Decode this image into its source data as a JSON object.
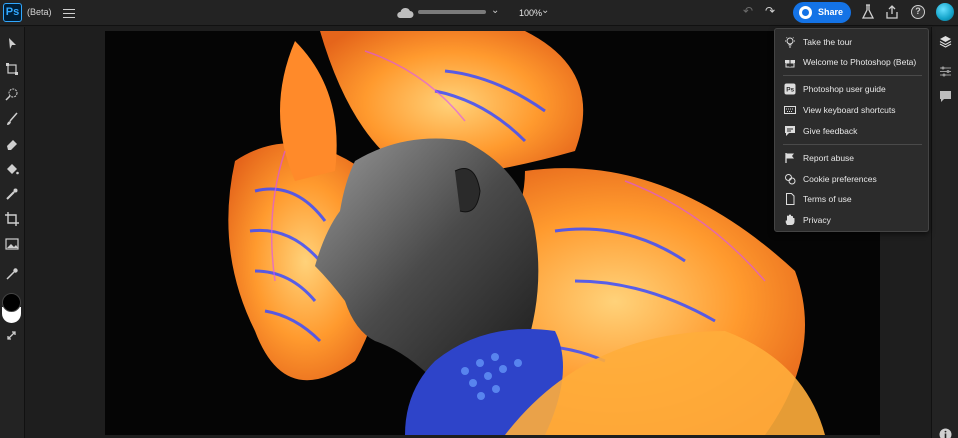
{
  "app": {
    "logo_text": "Ps",
    "title_suffix": "(Beta)"
  },
  "toolbar": {
    "zoom_level": "100%",
    "share_label": "Share"
  },
  "help_menu": {
    "items": [
      {
        "label": "Take the tour",
        "icon": "lightbulb-icon"
      },
      {
        "label": "Welcome to Photoshop (Beta)",
        "icon": "gift-icon"
      },
      {
        "label": "Photoshop user guide",
        "icon": "ps-guide-icon"
      },
      {
        "label": "View keyboard shortcuts",
        "icon": "keyboard-icon"
      },
      {
        "label": "Give feedback",
        "icon": "feedback-icon"
      },
      {
        "label": "Report abuse",
        "icon": "flag-icon"
      },
      {
        "label": "Cookie preferences",
        "icon": "cookie-icon"
      },
      {
        "label": "Terms of use",
        "icon": "document-icon"
      },
      {
        "label": "Privacy",
        "icon": "hand-icon"
      }
    ]
  },
  "tools": [
    "move-tool",
    "transform-tool",
    "quick-select-tool",
    "brush-tool",
    "eraser-tool",
    "paint-bucket-tool",
    "healing-tool",
    "crop-tool",
    "image-tool",
    "eyedropper-tool"
  ],
  "colors": {
    "foreground": "#000000",
    "background": "#ffffff",
    "accent": "#1473e6"
  },
  "right_panel": [
    "layers-icon",
    "adjustments-icon",
    "comments-icon",
    "info-icon"
  ]
}
